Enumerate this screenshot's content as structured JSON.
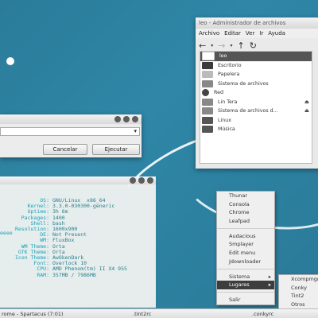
{
  "file_manager": {
    "title": "leo - Administrador de archivos",
    "menu": [
      "Archivo",
      "Editar",
      "Ver",
      "Ir",
      "Ayuda"
    ],
    "toolbar_icons": [
      "back-arrow-icon",
      "forward-arrow-icon",
      "up-arrow-icon",
      "reload-icon"
    ],
    "sidebar": [
      {
        "label": "leo",
        "icon": "home-icon",
        "selected": true
      },
      {
        "label": "Escritorio",
        "icon": "desktop-icon"
      },
      {
        "label": "Papelera",
        "icon": "trash-icon"
      },
      {
        "label": "Sistema de archivos",
        "icon": "drive-icon"
      },
      {
        "label": "Red",
        "icon": "network-icon"
      },
      {
        "label": "Lin Tera",
        "icon": "drive-icon",
        "eject": true
      },
      {
        "label": "Sistema de archivos d...",
        "icon": "drive-icon",
        "eject": true
      },
      {
        "label": "Linux",
        "icon": "folder-icon"
      },
      {
        "label": "Música",
        "icon": "folder-icon"
      }
    ]
  },
  "run_dialog": {
    "cancel_label": "Cancelar",
    "run_label": "Ejecutar"
  },
  "terminal": {
    "left_fragment": "eeee",
    "lines": [
      {
        "k": "OS:",
        "v": "GNU/Linux  x86_64"
      },
      {
        "k": "Kernel:",
        "v": "3.3.0-030300-generic"
      },
      {
        "k": "Uptime:",
        "v": "3h 6m"
      },
      {
        "k": "Packages:",
        "v": "1400"
      },
      {
        "k": "Shell:",
        "v": "bash"
      },
      {
        "k": "Resolution:",
        "v": "1600x900"
      },
      {
        "k": "DE:",
        "v": "Not Present"
      },
      {
        "k": "WM:",
        "v": "FluxBox"
      },
      {
        "k": "WM Theme:",
        "v": "Orta"
      },
      {
        "k": "GTK Theme:",
        "v": "Orta"
      },
      {
        "k": "Icon Theme:",
        "v": "AwOkenDark"
      },
      {
        "k": "Font:",
        "v": "Overlock 10"
      },
      {
        "k": "CPU:",
        "v": "AMD Phenom(tm) II X4 955"
      },
      {
        "k": "RAM:",
        "v": "357MB / 7986MB"
      }
    ]
  },
  "root_menu": {
    "items": [
      {
        "label": "Thunar"
      },
      {
        "label": "Consola"
      },
      {
        "label": "Chrome"
      },
      {
        "label": "Leafpad"
      },
      {
        "label": "",
        "sep": true
      },
      {
        "label": "Audacious"
      },
      {
        "label": "Smplayer"
      },
      {
        "label": "Edit menu"
      },
      {
        "label": "Jdownloader"
      },
      {
        "label": "",
        "sep": true
      },
      {
        "label": "Sistema",
        "submenu": true
      },
      {
        "label": "Lugares",
        "submenu": true,
        "highlighted": true
      },
      {
        "label": "",
        "sep": true
      },
      {
        "label": "Salir"
      }
    ]
  },
  "sub_menu": {
    "items": [
      "Xcompmgr",
      "Conky",
      "Tint2",
      "Otros"
    ]
  },
  "taskbar": {
    "items": [
      "rome - Spartacus (7:01)",
      ".tint2rc",
      ".conkyrc"
    ]
  }
}
